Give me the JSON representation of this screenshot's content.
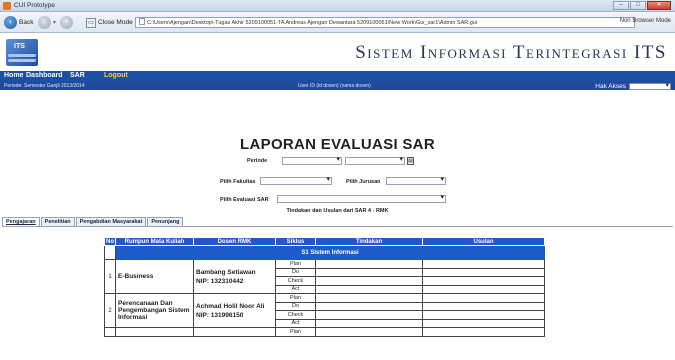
{
  "window": {
    "title": "CUI Prototype",
    "buttons": [
      "–",
      "□",
      "✕"
    ]
  },
  "toolbar": {
    "back_label": "Back",
    "close_mode_label": "Close Mode",
    "address": "C:\\Users\\Ajengan\\Desktop\\-Tugas Akhir 5209100051-TA Andreas Ajengan Dewantara 5209100051\\New Work\\Gui_sar1\\Admin SAR.gui",
    "non_browser_label": "Non Browser Mode"
  },
  "header": {
    "logo_text": "ITS",
    "system_title": "Sistem Informasi Terintegrasi ITS"
  },
  "menu": {
    "items": [
      "Home",
      "Dashboard",
      "SAR"
    ],
    "logout_label": "Logout"
  },
  "status": {
    "periode_text": "Periode: Semester Ganjil 2013/2014",
    "user_text": "User ID (id dosen)   (nama dosen)",
    "hak_akses_label": "Hak Akses"
  },
  "report": {
    "title": "LAPORAN EVALUASI SAR",
    "periode_label": "Periode",
    "fakultas_label": "Pilih Fakultas",
    "jurusan_label": "Pilih Jurusan",
    "evaluasi_label": "Pilih Evaluasi SAR",
    "caption": "Tindakan dan Usulan dari SAR 4 - RMK"
  },
  "tabs": [
    "Pengajaran",
    "Penelitian",
    "Pengabdian Masyarakat",
    "Penunjang"
  ],
  "table": {
    "headers": [
      "No",
      "Rumpun Mata Kuliah",
      "Dosen RMK",
      "Siklus",
      "Tindakan",
      "Usulan"
    ],
    "group_label": "S1 Sistem Informasi",
    "siklus": [
      "Plan",
      "Do",
      "Check",
      "Act"
    ],
    "rows": [
      {
        "no": "1",
        "matkul": "E-Business",
        "dosen": "Bambang Setiawan",
        "nip": "NIP: 132310442"
      },
      {
        "no": "2",
        "matkul": "Perencanaan Dan Pengembangan Sistem Informasi",
        "dosen": "Achmad Holil Noor Ali",
        "nip": "NIP: 131996150"
      }
    ],
    "partial_siklus": "Plan"
  }
}
